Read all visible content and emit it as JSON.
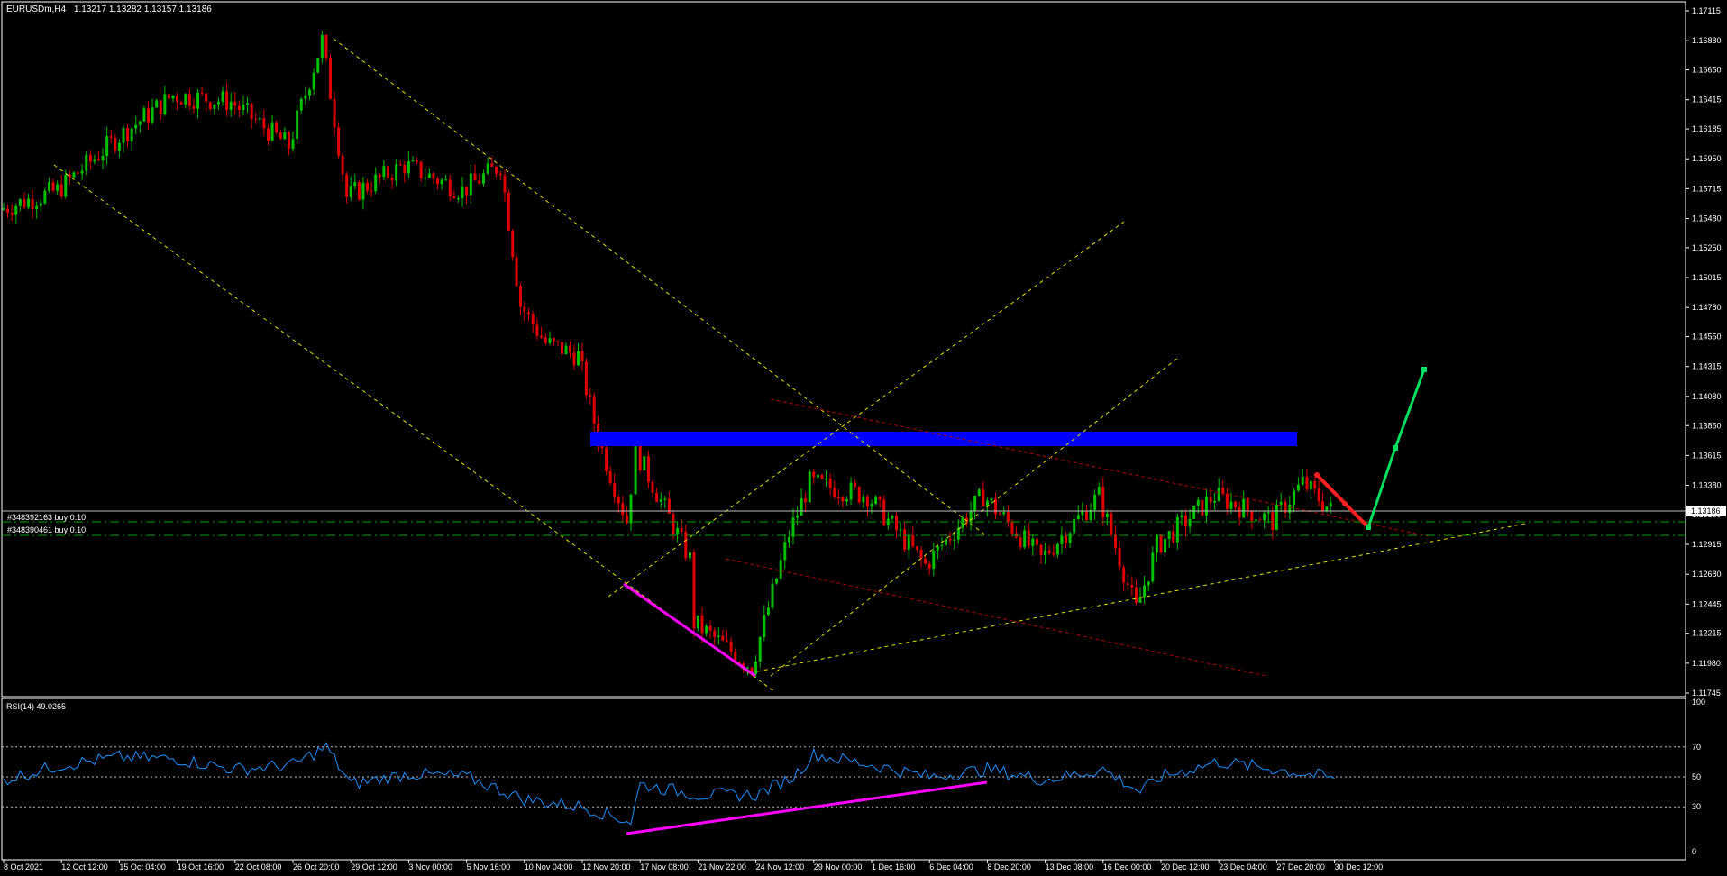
{
  "header": {
    "symbol_timeframe": "EURUSDm,H4",
    "ohlc": "1.13217 1.13282 1.13157 1.13186"
  },
  "price_axis": {
    "ticks": [
      "1.17115",
      "1.16880",
      "1.16650",
      "1.16415",
      "1.16185",
      "1.15950",
      "1.15715",
      "1.15480",
      "1.15250",
      "1.15015",
      "1.14780",
      "1.14550",
      "1.14315",
      "1.14080",
      "1.13850",
      "1.13615",
      "1.13380",
      "1.13150",
      "1.12915",
      "1.12680",
      "1.12445",
      "1.12215",
      "1.11980",
      "1.11745"
    ],
    "current_price": "1.13186"
  },
  "orders": [
    {
      "label": "#348392163 buy 0.10",
      "color": "#00a000"
    },
    {
      "label": "#348390461 buy 0.10",
      "color": "#00a000"
    }
  ],
  "rsi": {
    "label": "RSI(14) 49.0265",
    "levels": [
      "100",
      "70",
      "50",
      "30",
      "0"
    ],
    "line_color": "#1e90ff"
  },
  "time_axis": {
    "labels": [
      "8 Oct 2021",
      "12 Oct 12:00",
      "15 Oct 04:00",
      "19 Oct 16:00",
      "22 Oct 08:00",
      "26 Oct 20:00",
      "29 Oct 12:00",
      "3 Nov 00:00",
      "5 Nov 16:00",
      "10 Nov 04:00",
      "12 Nov 20:00",
      "17 Nov 08:00",
      "21 Nov 22:00",
      "24 Nov 12:00",
      "29 Nov 00:00",
      "1 Dec 16:00",
      "6 Dec 04:00",
      "8 Dec 20:00",
      "13 Dec 08:00",
      "16 Dec 00:00",
      "20 Dec 12:00",
      "23 Dec 04:00",
      "27 Dec 20:00",
      "30 Dec 12:00"
    ]
  },
  "colors": {
    "background": "#000000",
    "bull_candle": "#00c000",
    "bear_candle": "#e00000",
    "resistance_zone": "#0000ff",
    "divergence_line": "#ff00ff",
    "projection_up": "#00e060",
    "projection_down": "#ff2020",
    "trendline_yellow": "#e8e000",
    "channel_red": "#b00000",
    "grid_text": "#ffffff"
  },
  "chart_data": {
    "type": "candlestick",
    "symbol": "EURUSDm",
    "timeframe": "H4",
    "close_path": [
      [
        "8 Oct 2021",
        1.1555
      ],
      [
        "12 Oct 12:00",
        1.157
      ],
      [
        "15 Oct 04:00",
        1.161
      ],
      [
        "19 Oct 16:00",
        1.1645
      ],
      [
        "22 Oct 08:00",
        1.164
      ],
      [
        "26 Oct 20:00",
        1.1605
      ],
      [
        "27 Oct 16:00",
        1.1688
      ],
      [
        "29 Oct 12:00",
        1.1565
      ],
      [
        "3 Nov 00:00",
        1.159
      ],
      [
        "5 Nov 16:00",
        1.157
      ],
      [
        "9 Nov 20:00",
        1.159
      ],
      [
        "10 Nov 04:00",
        1.148
      ],
      [
        "11 Nov 12:00",
        1.145
      ],
      [
        "12 Nov 20:00",
        1.144
      ],
      [
        "15 Nov 12:00",
        1.1375
      ],
      [
        "16 Nov 04:00",
        1.131
      ],
      [
        "17 Nov 08:00",
        1.1365
      ],
      [
        "19 Nov 00:00",
        1.128
      ],
      [
        "21 Nov 22:00",
        1.123
      ],
      [
        "24 Nov 12:00",
        1.1195
      ],
      [
        "26 Nov 00:00",
        1.13
      ],
      [
        "29 Nov 00:00",
        1.134
      ],
      [
        "1 Dec 16:00",
        1.133
      ],
      [
        "6 Dec 04:00",
        1.1275
      ],
      [
        "8 Dec 20:00",
        1.133
      ],
      [
        "13 Dec 08:00",
        1.128
      ],
      [
        "16 Dec 00:00",
        1.133
      ],
      [
        "17 Dec 04:00",
        1.124
      ],
      [
        "20 Dec 12:00",
        1.129
      ],
      [
        "23 Dec 04:00",
        1.133
      ],
      [
        "27 Dec 20:00",
        1.131
      ],
      [
        "28 Dec 12:00",
        1.134
      ],
      [
        "30 Dec 12:00",
        1.13186
      ]
    ],
    "rsi_path": [
      [
        "8 Oct 2021",
        48
      ],
      [
        "12 Oct 12:00",
        58
      ],
      [
        "15 Oct 04:00",
        63
      ],
      [
        "19 Oct 16:00",
        62
      ],
      [
        "22 Oct 08:00",
        55
      ],
      [
        "26 Oct 20:00",
        58
      ],
      [
        "27 Oct 16:00",
        70
      ],
      [
        "29 Oct 12:00",
        45
      ],
      [
        "3 Nov 00:00",
        52
      ],
      [
        "5 Nov 16:00",
        50
      ],
      [
        "10 Nov 04:00",
        35
      ],
      [
        "12 Nov 20:00",
        30
      ],
      [
        "16 Nov 04:00",
        20
      ],
      [
        "17 Nov 08:00",
        45
      ],
      [
        "21 Nov 22:00",
        38
      ],
      [
        "24 Nov 12:00",
        38
      ],
      [
        "26 Nov 00:00",
        50
      ],
      [
        "29 Nov 00:00",
        65
      ],
      [
        "1 Dec 16:00",
        58
      ],
      [
        "6 Dec 04:00",
        50
      ],
      [
        "8 Dec 20:00",
        55
      ],
      [
        "13 Dec 08:00",
        48
      ],
      [
        "16 Dec 00:00",
        55
      ],
      [
        "17 Dec 04:00",
        40
      ],
      [
        "20 Dec 12:00",
        50
      ],
      [
        "23 Dec 04:00",
        60
      ],
      [
        "27 Dec 20:00",
        55
      ],
      [
        "30 Dec 12:00",
        49.0265
      ]
    ],
    "resistance_zone": {
      "from": 1.137,
      "to": 1.1385,
      "start": "12 Nov 20:00",
      "end": "29 Dec 00:00"
    },
    "order_levels": [
      1.1309,
      1.1298
    ],
    "projection": {
      "down": [
        [
          "29 Dec 00:00",
          1.1355
        ],
        [
          "31 Dec 00:00",
          1.1308
        ]
      ],
      "up": [
        [
          "31 Dec 00:00",
          1.1308
        ],
        [
          "1 Jan 08:00",
          1.1365
        ],
        [
          "2 Jan 04:00",
          1.143
        ]
      ]
    },
    "rsi_levels": [
      70,
      50,
      30
    ]
  }
}
